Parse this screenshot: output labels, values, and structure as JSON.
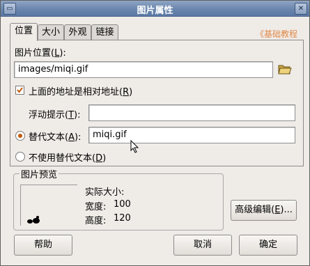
{
  "window": {
    "title": "图片属性"
  },
  "tabs": [
    "位置",
    "大小",
    "外观",
    "链接"
  ],
  "watermark": "《基础教程网》",
  "location": {
    "label_text": "图片位置(",
    "label_key": "L",
    "label_end": "):",
    "value": "images/miqi.gif",
    "folder_icon": "folder-open-icon"
  },
  "relative": {
    "checked": true,
    "label_text": "上面的地址是相对地址(",
    "label_key": "R",
    "label_end": ")"
  },
  "tooltip": {
    "label_text": "浮动提示(",
    "label_key": "T",
    "label_end": "):",
    "value": ""
  },
  "alt": {
    "selected": true,
    "label_text": "替代文本(",
    "label_key": "A",
    "label_end": "):",
    "value": "miqi.gif"
  },
  "no_alt": {
    "selected": false,
    "label_text": "不使用替代文本(",
    "label_key": "D",
    "label_end": ")"
  },
  "preview": {
    "title": "图片预览",
    "actual_size_label": "实际大小:",
    "width_label": "宽度:",
    "width_value": "100",
    "height_label": "高度:",
    "height_value": "120"
  },
  "buttons": {
    "advanced_text": "高级编辑(",
    "advanced_key": "E",
    "advanced_end": ")...",
    "help": "帮助",
    "cancel": "取消",
    "ok": "确定"
  }
}
